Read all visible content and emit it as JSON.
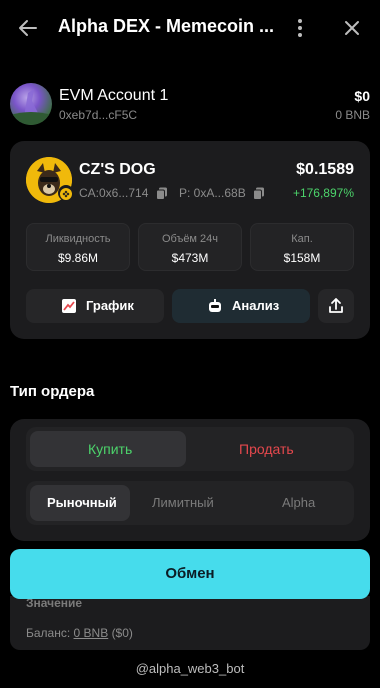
{
  "header": {
    "title": "Alpha DEX - Memecoin ...",
    "back_icon": "arrow-left-icon",
    "more_icon": "more-vertical-icon",
    "close_icon": "close-icon"
  },
  "account": {
    "name": "EVM Account 1",
    "address": "0xeb7d...cF5C",
    "balance_usd": "$0",
    "balance_bnb": "0 BNB"
  },
  "token": {
    "name": "CZ'S DOG",
    "ca": "CA:0x6...714",
    "pair": "P: 0xA...68B",
    "price": "$0.1589",
    "change": "+176,897%",
    "change_color": "#4cd46b",
    "stats": [
      {
        "label": "Ликвидность",
        "value": "$9.86M"
      },
      {
        "label": "Объём 24ч",
        "value": "$473M"
      },
      {
        "label": "Кап.",
        "value": "$158M"
      }
    ],
    "chart_label": "График",
    "analysis_label": "Анализ"
  },
  "order": {
    "title": "Тип ордера",
    "buy_label": "Купить",
    "sell_label": "Продать",
    "types": [
      "Рыночный",
      "Лимитный",
      "Alpha"
    ],
    "active_type": "Рыночный",
    "buy_color": "#4cd46b",
    "sell_color": "#e5484d"
  },
  "swap": {
    "label": "Обмен",
    "color": "#46dcec"
  },
  "under": {
    "label": "Значение",
    "balance_prefix": "Баланс:",
    "balance_link": "0 BNB",
    "balance_usd": "($0)"
  },
  "footer": {
    "bot": "@alpha_web3_bot"
  }
}
